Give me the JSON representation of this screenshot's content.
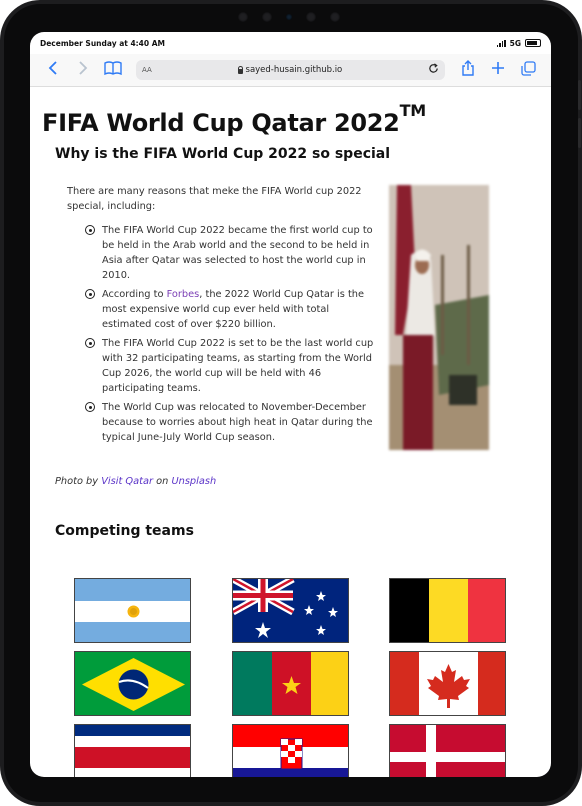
{
  "status": {
    "time": "December Sunday at 4:40 AM",
    "network": "5G"
  },
  "browser": {
    "reader_label": "AA",
    "url": "sayed-husain.github.io"
  },
  "page": {
    "title": "FIFA World Cup Qatar 2022",
    "title_sup": "TM",
    "subtitle": "Why is the FIFA World Cup 2022 so special",
    "intro": "There are many reasons that meke the FIFA World cup 2022 special, including:",
    "reasons": [
      {
        "pre": "The FIFA World Cup 2022 became the first world cup to be held in the Arab world and the second to be held in Asia after Qatar was selected to host the world cup in 2010.",
        "link": "",
        "post": ""
      },
      {
        "pre": "According to ",
        "link": "Forbes",
        "post": ", the 2022 World Cup Qatar is the most expensive world cup ever held with total estimated cost of over $220 billion."
      },
      {
        "pre": "The FIFA World Cup 2022 is set to be the last world cup with 32 participating teams, as starting from the World Cup 2026, the world cup will be held with 46 participating teams.",
        "link": "",
        "post": ""
      },
      {
        "pre": "The World Cup was relocated to November-December because to worries about high heat in Qatar during the typical June-July World Cup season.",
        "link": "",
        "post": ""
      }
    ],
    "credit": {
      "photo_by": "Photo by",
      "author": "Visit Qatar",
      "on": "on",
      "site": "Unsplash"
    },
    "teams_heading": "Competing teams",
    "flags": [
      "argentina-flag",
      "australia-flag",
      "belgium-flag",
      "brazil-flag",
      "cameroon-flag",
      "canada-flag",
      "costa-rica-flag",
      "croatia-flag",
      "denmark-flag"
    ]
  }
}
